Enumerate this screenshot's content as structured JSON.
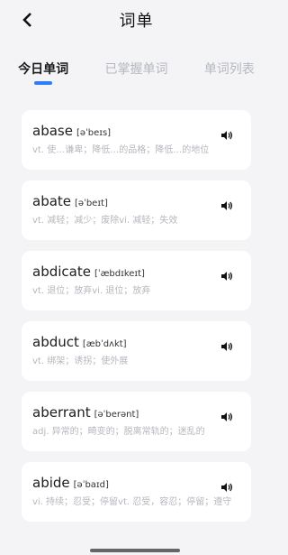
{
  "header": {
    "title": "词单"
  },
  "tabs": [
    {
      "label": "今日单词",
      "active": true
    },
    {
      "label": "已掌握单词",
      "active": false
    },
    {
      "label": "单词列表",
      "active": false
    }
  ],
  "words": [
    {
      "word": "abase",
      "phonetic": "[əˈbeɪs]",
      "meaning": "vt. 使…谦卑；降低…的品格；降低…的地位"
    },
    {
      "word": "abate",
      "phonetic": "[əˈbeɪt]",
      "meaning": "vt. 减轻；减少；废除vi. 减轻；失效"
    },
    {
      "word": "abdicate",
      "phonetic": "[ˈæbdɪkeɪt]",
      "meaning": "vt. 退位；放弃vi. 退位；放弃"
    },
    {
      "word": "abduct",
      "phonetic": "[æbˈdʌkt]",
      "meaning": "vt. 绑架；诱拐；使外展"
    },
    {
      "word": "aberrant",
      "phonetic": "[əˈberənt]",
      "meaning": "adj. 异常的；畸变的；脱离常轨的；迷乱的"
    },
    {
      "word": "abide",
      "phonetic": "[əˈbaɪd]",
      "meaning": "vi. 持续；忍受；停留vt. 忍受，容忍；停留；遵守"
    }
  ],
  "icons": {
    "back": "chevron-left-icon",
    "speaker": "speaker-icon"
  },
  "colors": {
    "accent": "#2d7ef7"
  }
}
